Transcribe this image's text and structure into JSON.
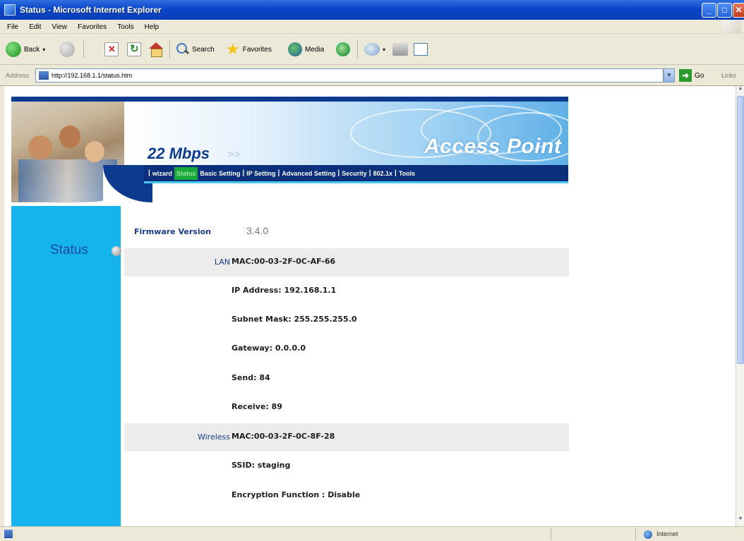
{
  "window": {
    "title": "Status - Microsoft Internet Explorer",
    "min_label": "_",
    "max_label": "□",
    "close_label": "✕"
  },
  "menubar": {
    "items": [
      "File",
      "Edit",
      "View",
      "Favorites",
      "Tools",
      "Help"
    ]
  },
  "toolbar": {
    "back_label": "Back",
    "search_label": "Search",
    "favorites_label": "Favorites",
    "media_label": "Media"
  },
  "addressbar": {
    "label": "Address",
    "url": "http://192.168.1.1/status.htm",
    "go_label": "Go",
    "links_label": "Links"
  },
  "banner": {
    "speed": "22 Mbps",
    "speed_arrows": ">>",
    "product": "Access Point",
    "nav": [
      {
        "label": "wizard",
        "active": false
      },
      {
        "label": "Status",
        "active": true
      },
      {
        "label": "Basic  Setting",
        "active": false
      },
      {
        "label": "IP Setting",
        "active": false
      },
      {
        "label": "Advanced Setting",
        "active": false
      },
      {
        "label": "Security",
        "active": false
      },
      {
        "label": "802.1x",
        "active": false
      },
      {
        "label": "Tools",
        "active": false
      }
    ]
  },
  "sidebar": {
    "title": "Status"
  },
  "status": {
    "firmware_label": "Firmware Version",
    "firmware_value": "3.4.0",
    "rows": [
      {
        "label": "LAN",
        "value": "MAC:00-03-2F-0C-AF-66",
        "shaded": true
      },
      {
        "label": "",
        "value": "IP Address: 192.168.1.1",
        "shaded": false
      },
      {
        "label": "",
        "value": "Subnet Mask: 255.255.255.0",
        "shaded": false
      },
      {
        "label": "",
        "value": "Gateway: 0.0.0.0",
        "shaded": false
      },
      {
        "label": "",
        "value": "Send: 84",
        "shaded": false
      },
      {
        "label": "",
        "value": "Receive: 89",
        "shaded": false
      },
      {
        "label": "Wireless",
        "value": "MAC:00-03-2F-0C-8F-28",
        "shaded": true
      },
      {
        "label": "",
        "value": "SSID: staging",
        "shaded": false
      },
      {
        "label": "",
        "value": "Encryption Function : Disable",
        "shaded": false
      }
    ]
  },
  "statusbar": {
    "zone": "Internet"
  },
  "colors": {
    "titlebar": "#0a46c8",
    "nav_bg": "#0b2f7a",
    "nav_active": "#19a83a",
    "sidepanel": "#16b4ee",
    "row_shade": "#ececec"
  }
}
